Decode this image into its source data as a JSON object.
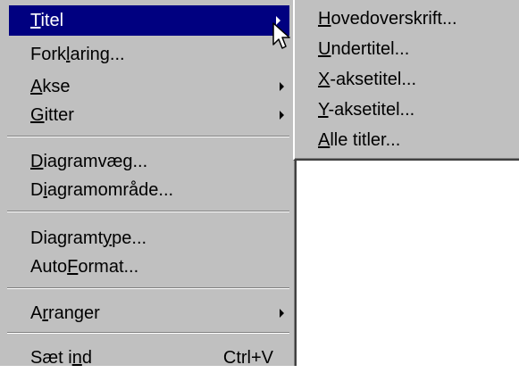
{
  "menu": {
    "items": [
      {
        "label": "Titel",
        "mnemonic": "T",
        "arrow": true,
        "highlighted": true
      },
      {
        "label": "Forklaring...",
        "mnemonic": "l"
      },
      {
        "label": "Akse",
        "mnemonic": "A",
        "arrow": true
      },
      {
        "label": "Gitter",
        "mnemonic": "G",
        "arrow": true
      },
      {
        "label": "Diagramvæg...",
        "mnemonic": "D"
      },
      {
        "label": "Diagramområde...",
        "mnemonic": "i"
      },
      {
        "label": "Diagramtype...",
        "mnemonic": "y"
      },
      {
        "label": "AutoFormat...",
        "mnemonic": "F"
      },
      {
        "label": "Arranger",
        "mnemonic": "r",
        "arrow": true
      },
      {
        "label": "Sæt ind",
        "mnemonic": "n",
        "shortcut": "Ctrl+V"
      }
    ]
  },
  "submenu": {
    "items": [
      {
        "label": "Hovedoverskrift...",
        "mnemonic": "H"
      },
      {
        "label": "Undertitel...",
        "mnemonic": "U"
      },
      {
        "label": "X-aksetitel...",
        "mnemonic": "X"
      },
      {
        "label": "Y-aksetitel...",
        "mnemonic": "Y"
      },
      {
        "label": "Alle titler...",
        "mnemonic": "A"
      }
    ]
  },
  "colors": {
    "menu_bg": "#c0c0c0",
    "highlight_bg": "#000080",
    "highlight_text": "#ffffff",
    "text": "#000000"
  },
  "icons": {
    "submenu_arrow": "right-triangle",
    "cursor": "arrow-cursor"
  }
}
